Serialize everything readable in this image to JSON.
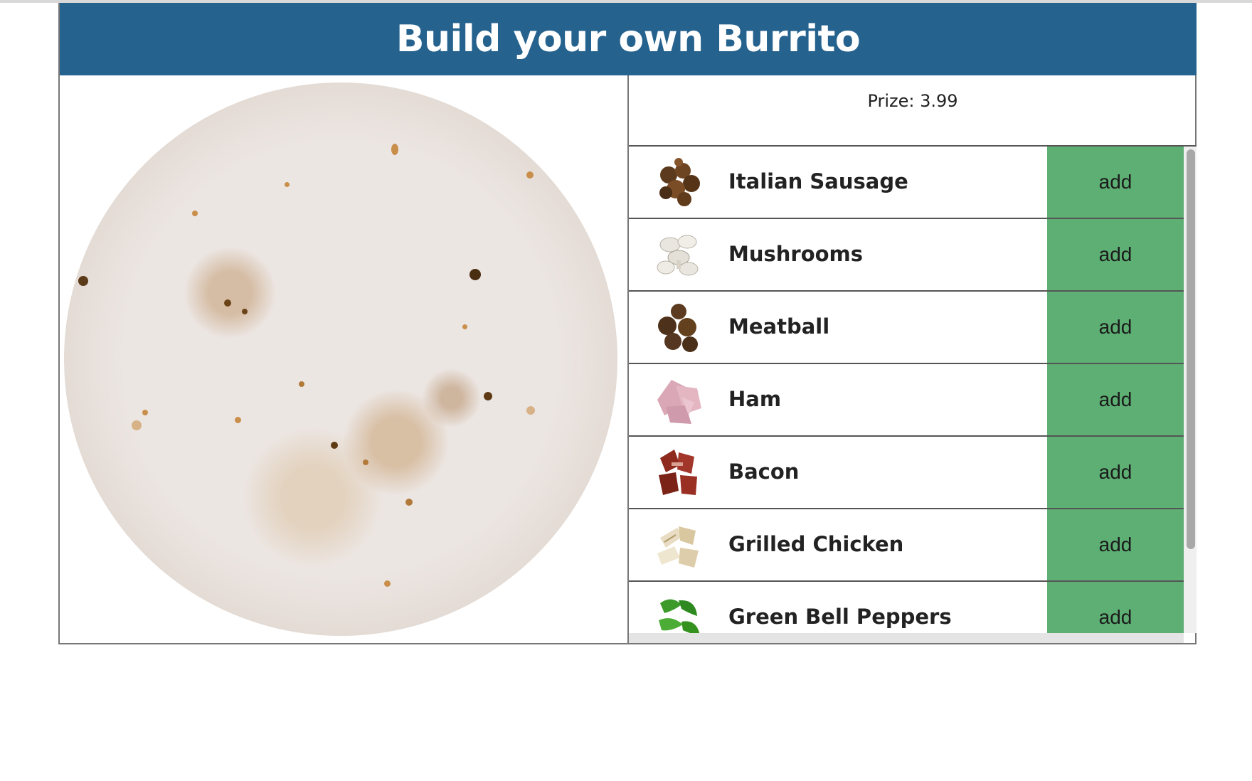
{
  "header": {
    "title": "Build your own Burrito"
  },
  "price": {
    "label": "Prize: 3.99"
  },
  "ingredients": [
    {
      "name": "Italian Sausage",
      "button": "add",
      "icon": "sausage-icon"
    },
    {
      "name": "Mushrooms",
      "button": "add",
      "icon": "mushroom-icon"
    },
    {
      "name": "Meatball",
      "button": "add",
      "icon": "meatball-icon"
    },
    {
      "name": "Ham",
      "button": "add",
      "icon": "ham-icon"
    },
    {
      "name": "Bacon",
      "button": "add",
      "icon": "bacon-icon"
    },
    {
      "name": "Grilled Chicken",
      "button": "add",
      "icon": "chicken-icon"
    },
    {
      "name": "Green Bell Peppers",
      "button": "add",
      "icon": "pepper-icon"
    }
  ],
  "colors": {
    "header_bg": "#25628e",
    "add_button_bg": "#5daf73"
  }
}
